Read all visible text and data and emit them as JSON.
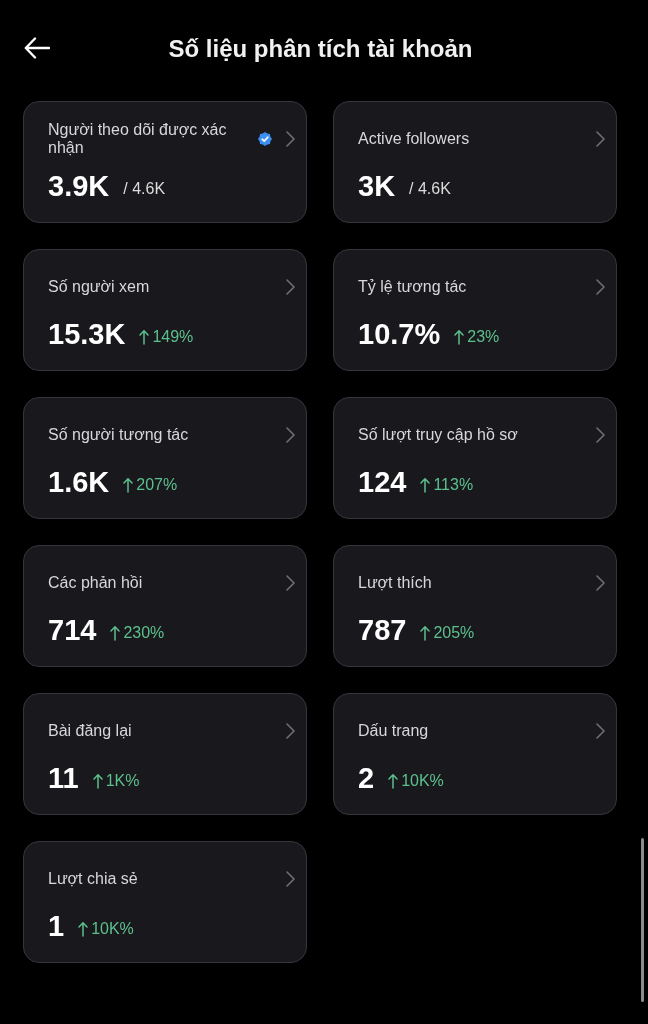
{
  "header": {
    "title": "Số liệu phân tích tài khoản"
  },
  "metrics": [
    {
      "kind": "ratio",
      "label": "Người theo dõi được xác nhận",
      "verified": true,
      "value": "3.9K",
      "total": "/ 4.6K"
    },
    {
      "kind": "ratio",
      "label": "Active followers",
      "verified": false,
      "value": "3K",
      "total": "/ 4.6K"
    },
    {
      "kind": "change",
      "label": "Số người xem",
      "verified": false,
      "value": "15.3K",
      "rising": true,
      "change": "149%"
    },
    {
      "kind": "change",
      "label": "Tỷ lệ tương tác",
      "verified": false,
      "value": "10.7%",
      "rising": true,
      "change": "23%"
    },
    {
      "kind": "change",
      "label": "Số người tương tác",
      "verified": false,
      "value": "1.6K",
      "rising": true,
      "change": "207%"
    },
    {
      "kind": "change",
      "label": "Số lượt truy cập hồ sơ",
      "verified": false,
      "value": "124",
      "rising": true,
      "change": "113%"
    },
    {
      "kind": "change",
      "label": "Các phản hồi",
      "verified": false,
      "value": "714",
      "rising": true,
      "change": "230%"
    },
    {
      "kind": "change",
      "label": "Lượt thích",
      "verified": false,
      "value": "787",
      "rising": true,
      "change": "205%"
    },
    {
      "kind": "change",
      "label": "Bài đăng lại",
      "verified": false,
      "value": "11",
      "rising": true,
      "change": "1K%"
    },
    {
      "kind": "change",
      "label": "Dấu trang",
      "verified": false,
      "value": "2",
      "rising": true,
      "change": "10K%"
    },
    {
      "kind": "change",
      "label": "Lượt chia sẻ",
      "verified": false,
      "value": "1",
      "rising": true,
      "change": "10K%"
    }
  ]
}
